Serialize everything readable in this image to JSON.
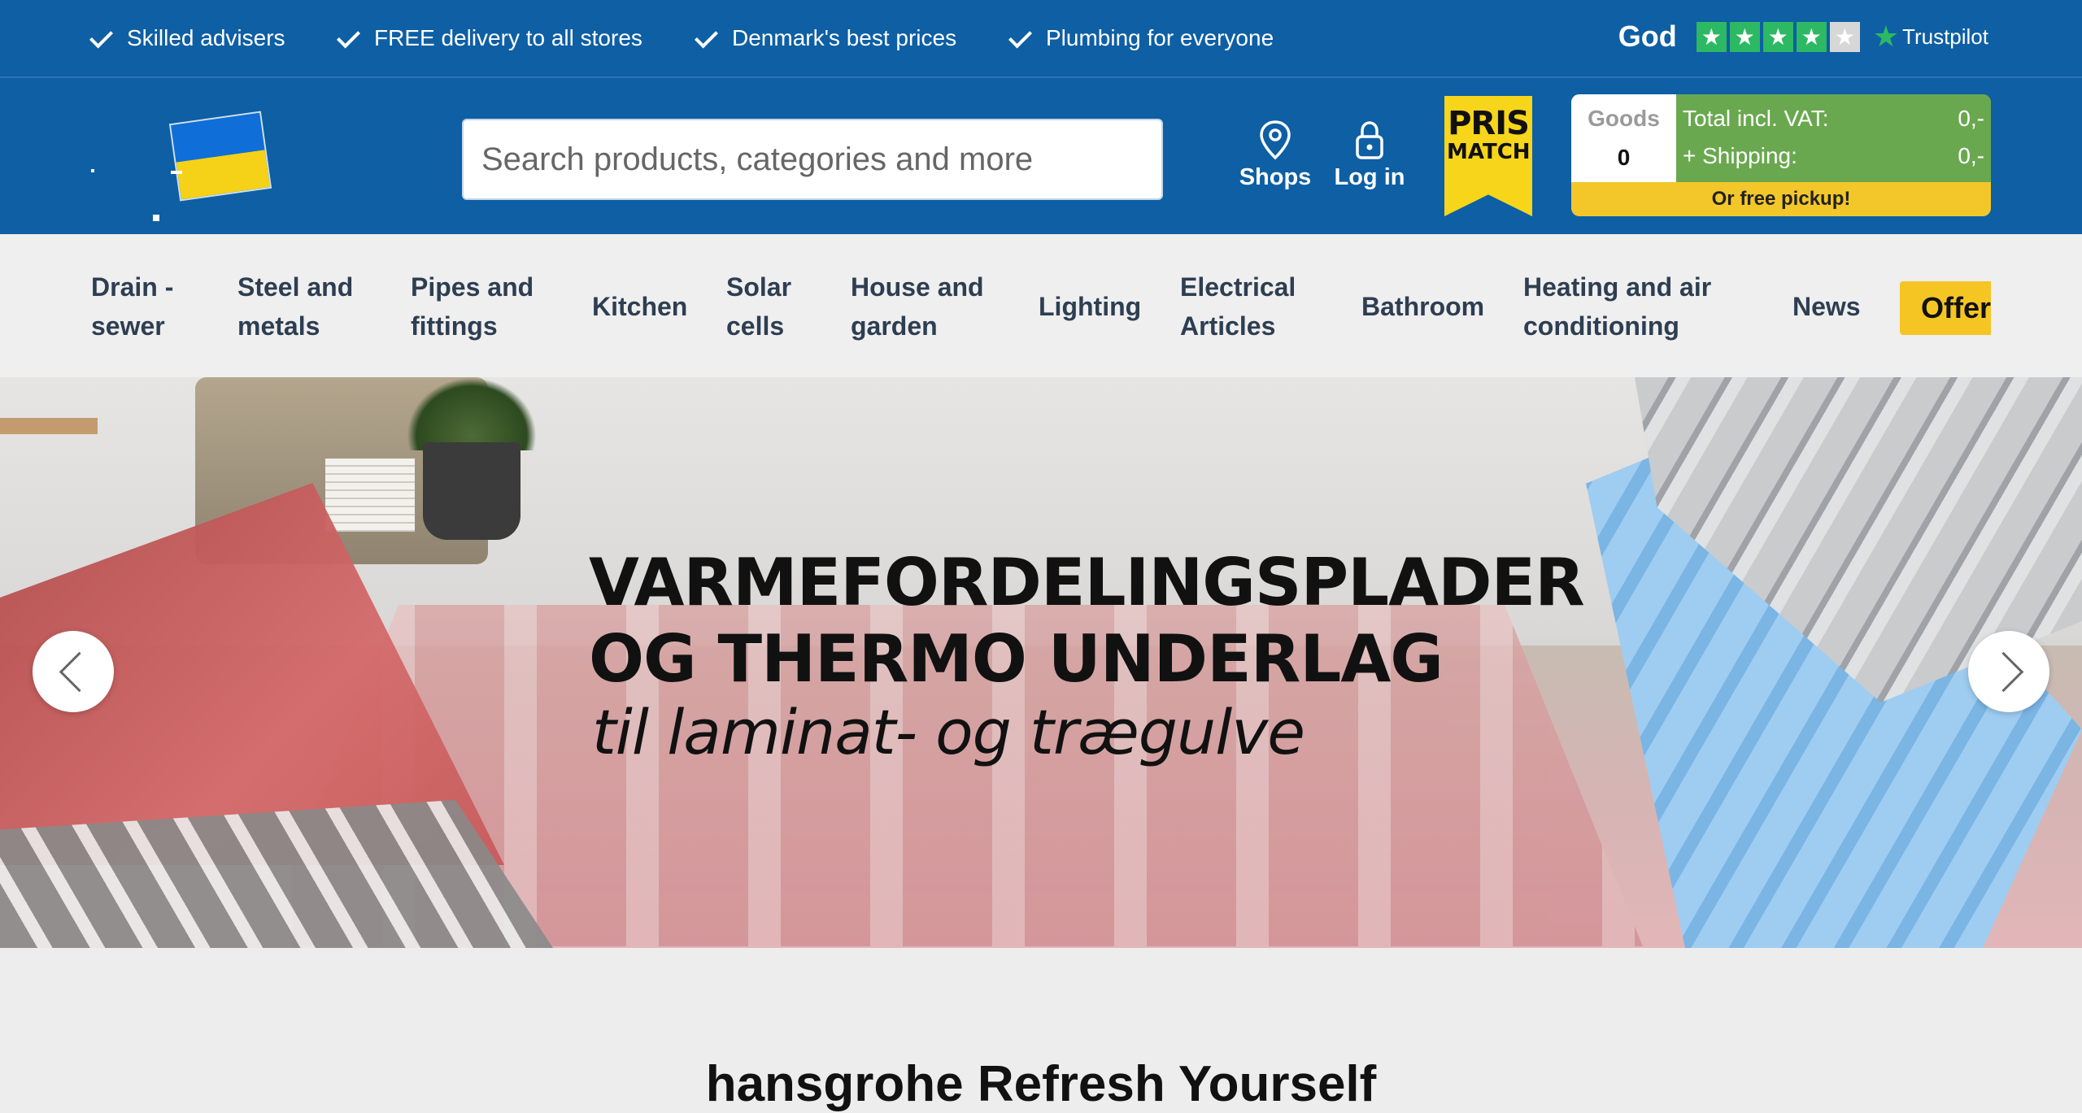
{
  "usp": [
    {
      "label": "Skilled advisers"
    },
    {
      "label": "FREE delivery to all stores"
    },
    {
      "label": "Denmark's best prices"
    },
    {
      "label": "Plumbing for everyone"
    }
  ],
  "trustpilot": {
    "rating_label": "God",
    "stars_filled": 4,
    "stars_total": 5,
    "brand": "Trustpilot",
    "star_color": "#2db864"
  },
  "header": {
    "search_placeholder": "Search products, categories and more",
    "shops_label": "Shops",
    "login_label": "Log in",
    "prismatch_line1": "PRIS",
    "prismatch_line2": "MATCH",
    "brand_color": "#0e5fa4",
    "cart": {
      "goods_label": "Goods",
      "goods_count": "0",
      "total_label": "Total incl. VAT:",
      "total_value": "0,-",
      "shipping_label": "+ Shipping:",
      "shipping_value": "0,-",
      "pickup_label": "Or free pickup!"
    }
  },
  "nav": {
    "items": [
      {
        "line1": "Drain -",
        "line2": "sewer"
      },
      {
        "line1": "Steel and",
        "line2": "metals"
      },
      {
        "line1": "Pipes and",
        "line2": "fittings"
      },
      {
        "line1": "Kitchen",
        "line2": ""
      },
      {
        "line1": "Solar",
        "line2": "cells"
      },
      {
        "line1": "House and",
        "line2": "garden"
      },
      {
        "line1": "Lighting",
        "line2": ""
      },
      {
        "line1": "Electrical",
        "line2": "Articles"
      },
      {
        "line1": "Bathroom",
        "line2": ""
      },
      {
        "line1": "Heating and air",
        "line2": "conditioning"
      },
      {
        "line1": "News",
        "line2": ""
      }
    ],
    "offer_label": "Offer",
    "offer_color": "#f5c524"
  },
  "hero": {
    "title_line1": "VARMEFORDELINGSPLADER",
    "title_line2": "OG THERMO UNDERLAG",
    "subtitle": "til laminat- og trægulve"
  },
  "section": {
    "title": "hansgrohe Refresh Yourself"
  }
}
